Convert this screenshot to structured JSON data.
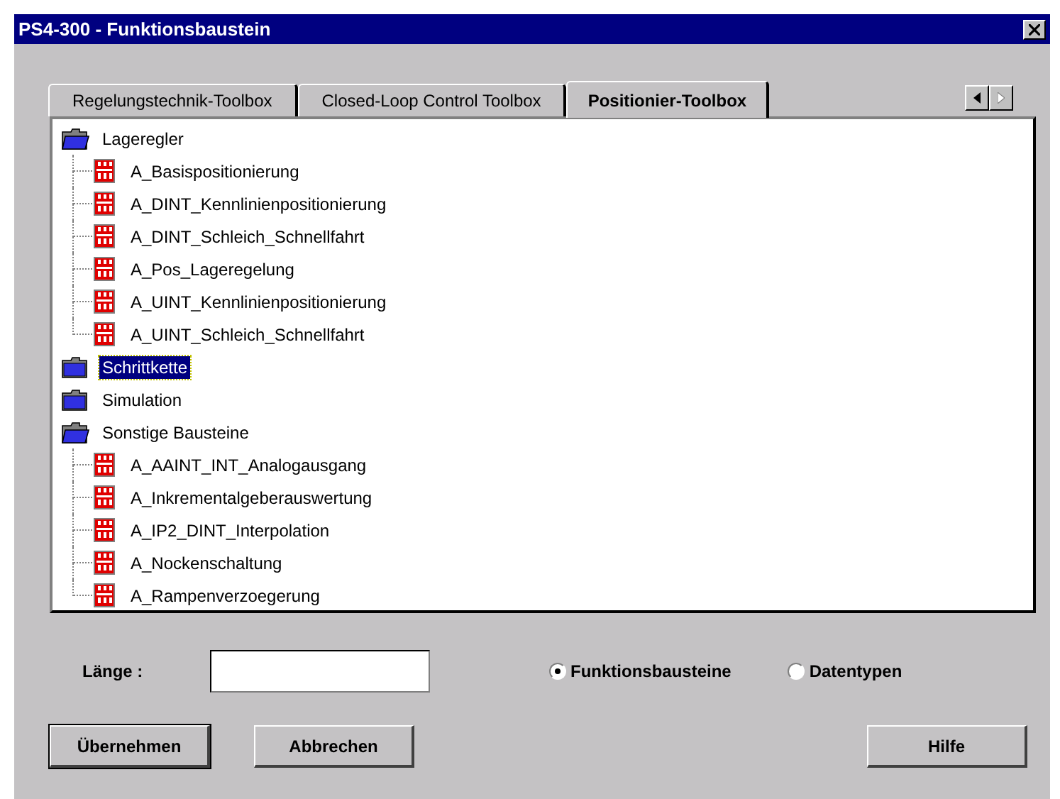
{
  "window": {
    "title": "PS4-300 - Funktionsbaustein"
  },
  "tabs": [
    {
      "label": "Regelungstechnik-Toolbox",
      "selected": false
    },
    {
      "label": "Closed-Loop Control Toolbox",
      "selected": false
    },
    {
      "label": "Positionier-Toolbox",
      "selected": true
    }
  ],
  "tab_scroll": {
    "left_disabled": false,
    "right_disabled": true
  },
  "tree": [
    {
      "label": "Lageregler",
      "kind": "folder",
      "expanded": true,
      "selected": false,
      "children": [
        {
          "label": "A_Basispositionierung",
          "kind": "block",
          "selected": false
        },
        {
          "label": "A_DINT_Kennlinienpositionierung",
          "kind": "block",
          "selected": false
        },
        {
          "label": "A_DINT_Schleich_Schnellfahrt",
          "kind": "block",
          "selected": false
        },
        {
          "label": "A_Pos_Lageregelung",
          "kind": "block",
          "selected": false
        },
        {
          "label": "A_UINT_Kennlinienpositionierung",
          "kind": "block",
          "selected": false
        },
        {
          "label": "A_UINT_Schleich_Schnellfahrt",
          "kind": "block",
          "selected": false
        }
      ]
    },
    {
      "label": "Schrittkette",
      "kind": "folder",
      "expanded": false,
      "selected": true
    },
    {
      "label": "Simulation",
      "kind": "folder",
      "expanded": false,
      "selected": false
    },
    {
      "label": "Sonstige Bausteine",
      "kind": "folder",
      "expanded": true,
      "selected": false,
      "children": [
        {
          "label": "A_AAINT_INT_Analogausgang",
          "kind": "block",
          "selected": false
        },
        {
          "label": "A_Inkrementalgeberauswertung",
          "kind": "block",
          "selected": false
        },
        {
          "label": "A_IP2_DINT_Interpolation",
          "kind": "block",
          "selected": false
        },
        {
          "label": "A_Nockenschaltung",
          "kind": "block",
          "selected": false
        },
        {
          "label": "A_Rampenverzoegerung",
          "kind": "block",
          "selected": false
        }
      ]
    }
  ],
  "length_field": {
    "label": "Länge :"
  },
  "radios": [
    {
      "label": "Funktionsbausteine",
      "selected": true
    },
    {
      "label": "Datentypen",
      "selected": false
    }
  ],
  "buttons": [
    {
      "label": "Übernehmen",
      "default": true
    },
    {
      "label": "Abbrechen",
      "default": false
    },
    {
      "label": "Hilfe",
      "default": false
    }
  ]
}
